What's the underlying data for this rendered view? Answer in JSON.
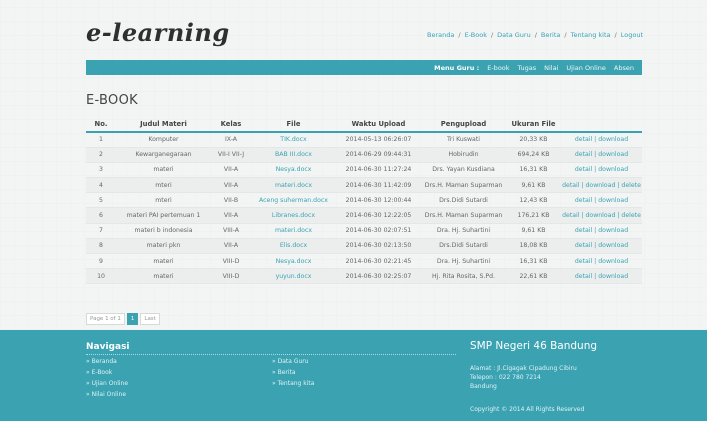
{
  "header": {
    "logo": "e-learning",
    "nav": [
      "Beranda",
      "E-Book",
      "Data Guru",
      "Berita",
      "Tentang kita",
      "Logout"
    ],
    "nav_sep": "/"
  },
  "menu": {
    "label": "Menu Guru :",
    "items": [
      "E-book",
      "Tugas",
      "Nilai",
      "Ujian Online",
      "Absen"
    ]
  },
  "page_title": "E-BOOK",
  "table": {
    "columns": [
      "No.",
      "Judul Materi",
      "Kelas",
      "File",
      "Waktu Upload",
      "Pengupload",
      "Ukuran File",
      ""
    ],
    "rows": [
      {
        "no": "1",
        "judul": "Komputer",
        "kelas": "IX-A",
        "file": "TIK.docx",
        "waktu": "2014-05-13 06:26:07",
        "pengupload": "Tri Kuswati",
        "ukuran": "20,33 KB",
        "actions": "detail | download"
      },
      {
        "no": "2",
        "judul": "Kewarganegaraan",
        "kelas": "VII-I VII-J",
        "file": "BAB III.docx",
        "waktu": "2014-06-29 09:44:31",
        "pengupload": "Hobirudin",
        "ukuran": "694,24 KB",
        "actions": "detail | download"
      },
      {
        "no": "3",
        "judul": "materi",
        "kelas": "VII-A",
        "file": "Nesya.docx",
        "waktu": "2014-06-30 11:27:24",
        "pengupload": "Drs. Yayan Kusdiana",
        "ukuran": "16,31 KB",
        "actions": "detail | download"
      },
      {
        "no": "4",
        "judul": "mteri",
        "kelas": "VII-A",
        "file": "materi.docx",
        "waktu": "2014-06-30 11:42:09",
        "pengupload": "Drs.H. Maman Suparman",
        "ukuran": "9,61 KB",
        "actions": "detail | download | delete"
      },
      {
        "no": "5",
        "judul": "mteri",
        "kelas": "VII-B",
        "file": "Aceng suherman.docx",
        "waktu": "2014-06-30 12:00:44",
        "pengupload": "Drs.Didi Sutardi",
        "ukuran": "12,43 KB",
        "actions": "detail | download"
      },
      {
        "no": "6",
        "judul": "materi PAI pertemuan 1",
        "kelas": "VII-A",
        "file": "Libranes.docx",
        "waktu": "2014-06-30 12:22:05",
        "pengupload": "Drs.H. Maman Suparman",
        "ukuran": "176,21 KB",
        "actions": "detail | download | delete"
      },
      {
        "no": "7",
        "judul": "materi b indonesia",
        "kelas": "VIII-A",
        "file": "materi.docx",
        "waktu": "2014-06-30 02:07:51",
        "pengupload": "Dra. Hj. Suhartini",
        "ukuran": "9,61 KB",
        "actions": "detail | download"
      },
      {
        "no": "8",
        "judul": "materi pkn",
        "kelas": "VII-A",
        "file": "Elis.docx",
        "waktu": "2014-06-30 02:13:50",
        "pengupload": "Drs.Didi Sutardi",
        "ukuran": "18,08 KB",
        "actions": "detail | download"
      },
      {
        "no": "9",
        "judul": "materi",
        "kelas": "VIII-D",
        "file": "Nesya.docx",
        "waktu": "2014-06-30 02:21:45",
        "pengupload": "Dra. Hj. Suhartini",
        "ukuran": "16,31 KB",
        "actions": "detail | download"
      },
      {
        "no": "10",
        "judul": "materi",
        "kelas": "VIII-D",
        "file": "yuyun.docx",
        "waktu": "2014-06-30 02:25:07",
        "pengupload": "Hj. Rita Rosita, S.Pd.",
        "ukuran": "22,61 KB",
        "actions": "detail | download"
      }
    ]
  },
  "pager": {
    "info": "Page 1 of 1",
    "current": "1",
    "last": "Last"
  },
  "footer": {
    "nav_title": "Navigasi",
    "col1": [
      "» Beranda",
      "» E-Book",
      "» Ujian Online",
      "» Nilai Online"
    ],
    "col2": [
      "» Data Guru",
      "» Berita",
      "» Tentang kita"
    ],
    "school": "SMP Negeri 46 Bandung",
    "address": "Alamat : Jl.Cigagak Cipadung Cibiru",
    "phone": "Telepon : 022 780 7214",
    "city": "Bandung",
    "copyright": "Copyright © 2014 All Rights Reserved"
  },
  "colors": {
    "accent": "#3ba2b2",
    "link": "#3aa3b2"
  }
}
